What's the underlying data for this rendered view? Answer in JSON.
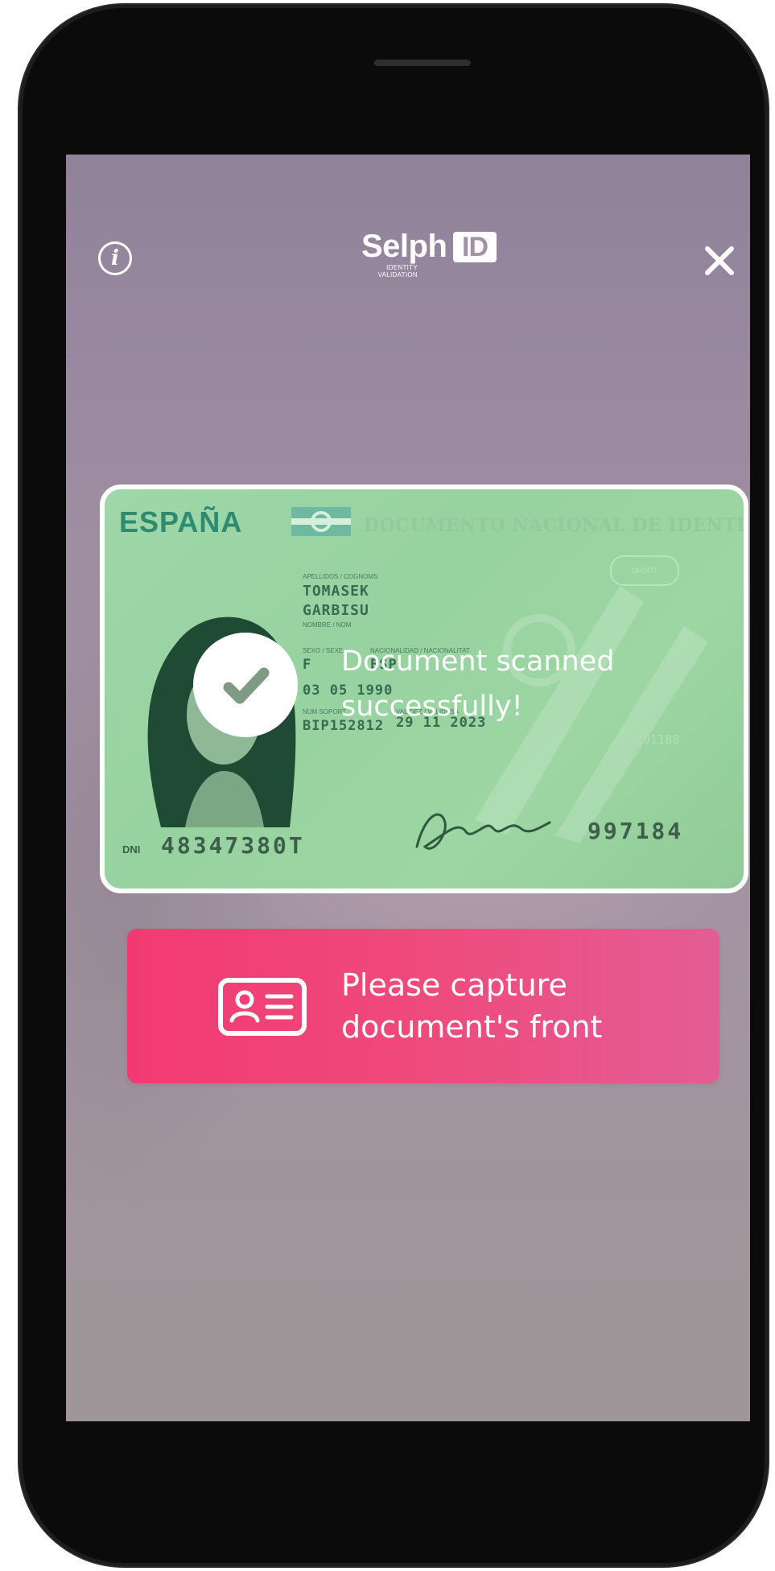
{
  "header": {
    "logo_word": "Selph",
    "logo_box": "ID",
    "logo_tagline": "IDENTITY\nVALIDATION",
    "info_icon": "info-icon",
    "close_icon": "close-icon"
  },
  "card": {
    "country": "ESPAÑA",
    "title": "DOCUMENTO NACIONAL DE IDENTIDAD",
    "badge": "DPDOT",
    "surname_label": "APELLIDOS / COGNOMS",
    "surname_1": "TOMASEK",
    "surname_2": "GARBISU",
    "name_label": "NOMBRE / NOM",
    "sex_label": "SEXO / SEXE",
    "nationality_label": "NACIONALIDAD / NACIONALITAT",
    "sex": "F",
    "nationality": "ESP",
    "birth": "03 05 1990",
    "support_label": "NUM SOPORT",
    "validity_label": "VALIDEZ / VALIDESA",
    "support": "BIP152812",
    "validity": "29 11 2023",
    "dni_label": "DNI",
    "dni_number": "48347380T",
    "serial": "997184",
    "faint_number": "291188"
  },
  "status": {
    "message": "Document scanned successfully!",
    "check_icon": "check-icon"
  },
  "prompt": {
    "text": "Please capture document's front",
    "icon": "id-card-icon"
  },
  "colors": {
    "accent_pink": "#F23A72",
    "card_tint": "#A8DDB0",
    "phone_frame": "#0B0B0B"
  }
}
